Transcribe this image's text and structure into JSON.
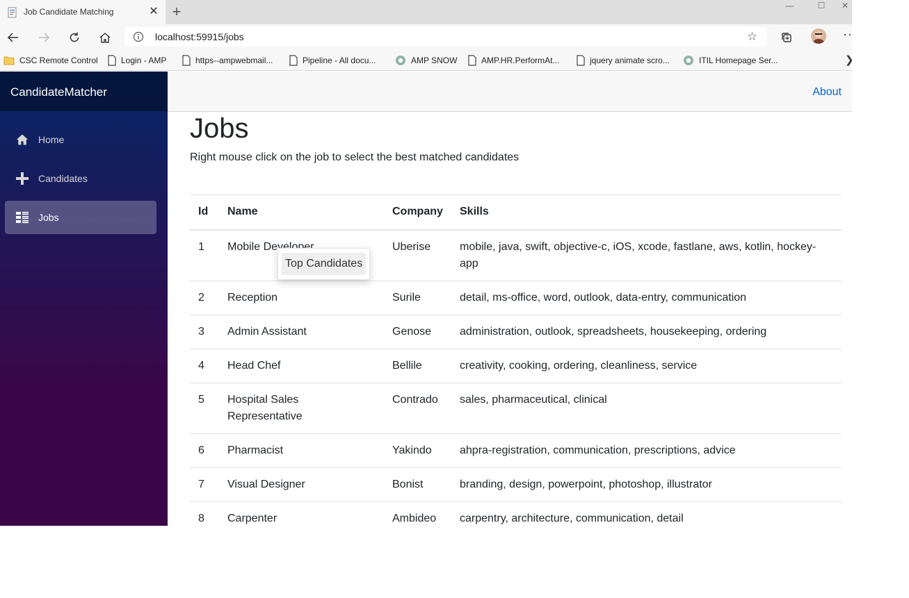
{
  "browser": {
    "tab_title": "Job Candidate Matching",
    "tab_close": "✕",
    "new_tab": "+",
    "window_controls": {
      "minimize": "—",
      "maximize": "☐",
      "close": "✕"
    },
    "url": "localhost:59915/jobs",
    "more_menu": "···",
    "bookmarks": [
      {
        "label": "CSC Remote Control",
        "icon": "folder-icon"
      },
      {
        "label": "Login - AMP",
        "icon": "page-icon"
      },
      {
        "label": "https--ampwebmail...",
        "icon": "page-icon"
      },
      {
        "label": "Pipeline - All docu...",
        "icon": "page-icon"
      },
      {
        "label": "AMP SNOW",
        "icon": "globe-icon"
      },
      {
        "label": "AMP.HR.PerformAt...",
        "icon": "page-icon"
      },
      {
        "label": "jquery animate scro...",
        "icon": "page-icon"
      },
      {
        "label": "ITIL Homepage  Ser...",
        "icon": "globe-icon"
      }
    ],
    "bookmarks_overflow": "❯"
  },
  "app": {
    "brand": "CandidateMatcher",
    "nav": [
      {
        "label": "Home",
        "icon": "home-icon",
        "active": false
      },
      {
        "label": "Candidates",
        "icon": "plus-icon",
        "active": false
      },
      {
        "label": "Jobs",
        "icon": "list-icon",
        "active": true
      }
    ],
    "top_link": "About"
  },
  "page": {
    "title": "Jobs",
    "description": "Right mouse click on the job to select the best matched candidates"
  },
  "table": {
    "headers": [
      "Id",
      "Name",
      "Company",
      "Skills"
    ],
    "rows": [
      {
        "id": "1",
        "name": "Mobile Developer",
        "company": "Uberise",
        "skills": "mobile, java, swift, objective-c, iOS, xcode, fastlane, aws, kotlin, hockey-app"
      },
      {
        "id": "2",
        "name": "Reception",
        "company": "Surile",
        "skills": "detail, ms-office, word, outlook, data-entry, communication"
      },
      {
        "id": "3",
        "name": "Admin Assistant",
        "company": "Genose",
        "skills": "administration, outlook, spreadsheets, housekeeping, ordering"
      },
      {
        "id": "4",
        "name": "Head Chef",
        "company": "Bellile",
        "skills": "creativity, cooking, ordering, cleanliness, service"
      },
      {
        "id": "5",
        "name": "Hospital Sales Representative",
        "company": "Contrado",
        "skills": "sales, pharmaceutical, clinical"
      },
      {
        "id": "6",
        "name": "Pharmacist",
        "company": "Yakindo",
        "skills": "ahpra-registration, communication, prescriptions, advice"
      },
      {
        "id": "7",
        "name": "Visual Designer",
        "company": "Bonist",
        "skills": "branding, design, powerpoint, photoshop, illustrator"
      },
      {
        "id": "8",
        "name": "Carpenter",
        "company": "Ambideo",
        "skills": "carpentry, architecture, communication, detail"
      }
    ]
  },
  "context_menu": {
    "items": [
      "Top Candidates"
    ]
  }
}
